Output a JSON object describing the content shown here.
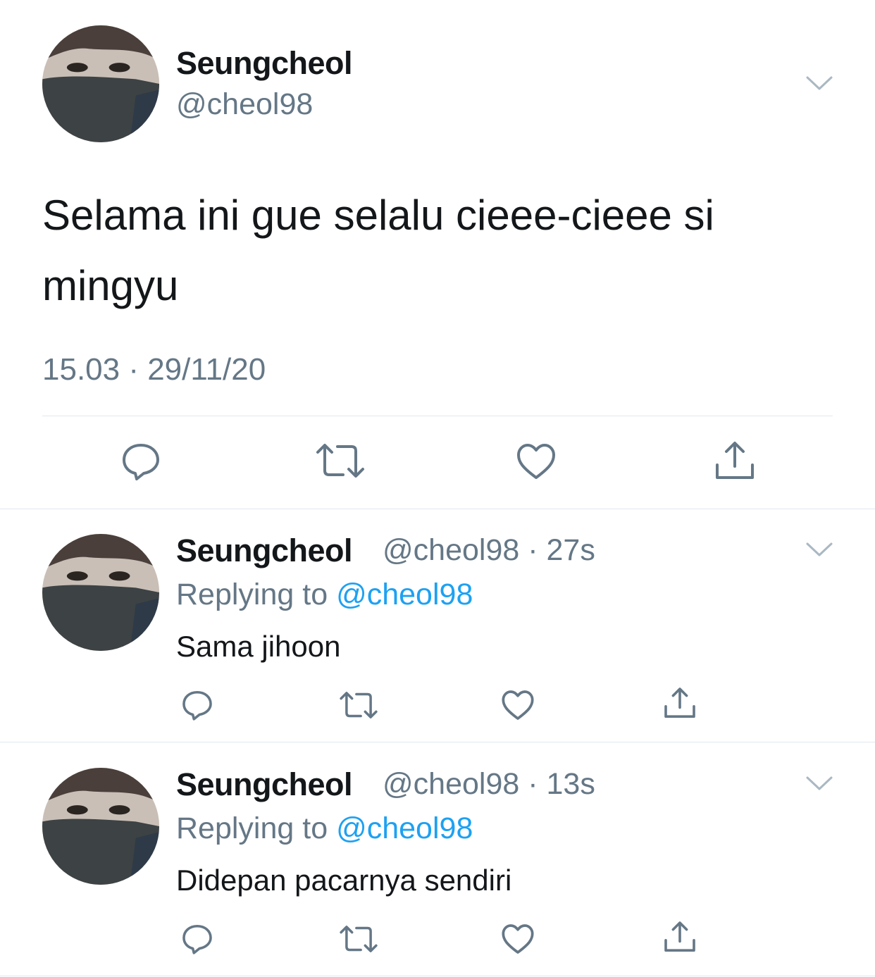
{
  "main_tweet": {
    "display_name": "Seungcheol",
    "handle": "@cheol98",
    "text": "Selama ini gue selalu cieee-cieee si mingyu",
    "timestamp": "15.03 · 29/11/20",
    "actions": [
      "reply-icon",
      "retweet-icon",
      "like-icon",
      "share-icon"
    ]
  },
  "replies": [
    {
      "display_name": "Seungcheol",
      "handle_time": "@cheol98 · 27s",
      "replying_prefix": "Replying to ",
      "replying_mention": "@cheol98",
      "text": "Sama jihoon"
    },
    {
      "display_name": "Seungcheol",
      "handle_time": "@cheol98 · 13s",
      "replying_prefix": "Replying to ",
      "replying_mention": "@cheol98",
      "text": "Didepan pacarnya sendiri"
    }
  ],
  "colors": {
    "text_primary": "#14171a",
    "text_secondary": "#657786",
    "link": "#1da1f2",
    "divider": "#e1e8ed",
    "icon": "#657786"
  }
}
